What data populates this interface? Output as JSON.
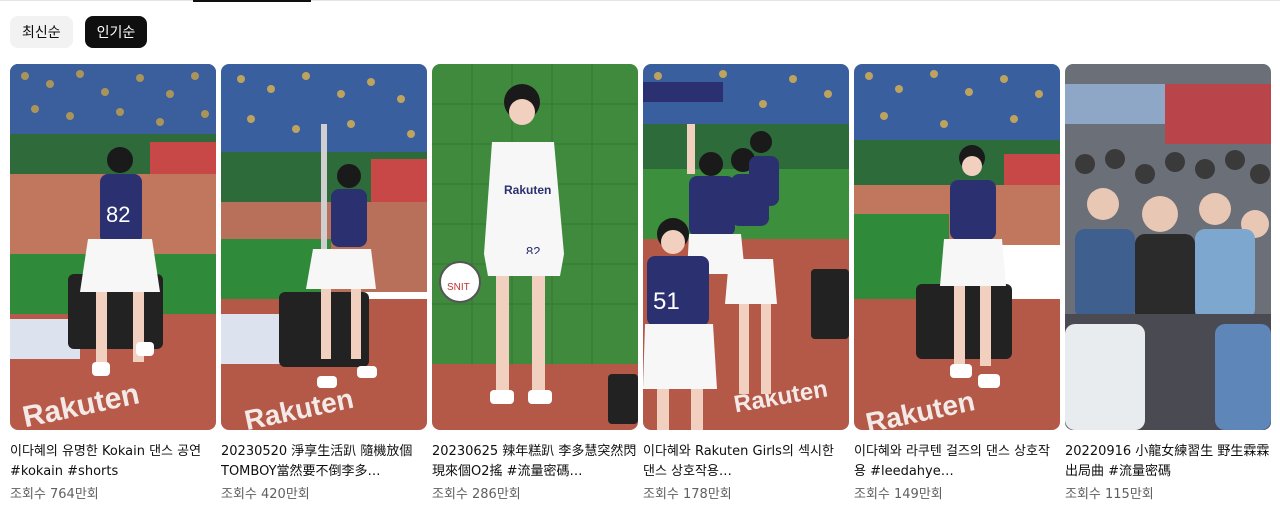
{
  "sort_chips": [
    {
      "label": "최신순",
      "active": false
    },
    {
      "label": "인기순",
      "active": true
    }
  ],
  "shorts": [
    {
      "title": "이다혜의 유명한 Kokain 댄스 공연 #kokain #shorts",
      "views": "조회수 764만회",
      "jersey": "82",
      "banner": "Rakuten"
    },
    {
      "title": "20230520 淨享生活趴 隨機放個TOMBOY當然要不倒李多…",
      "views": "조회수 420만회",
      "jersey": "",
      "banner": "Rakuten"
    },
    {
      "title": "20230625 辣年糕趴 李多慧突然閃現來個O2搖 #流量密碼…",
      "views": "조회수 286만회",
      "jersey": "82",
      "banner": ""
    },
    {
      "title": "이다혜와 Rakuten Girls의 섹시한 댄스 상호작용…",
      "views": "조회수 178만회",
      "jersey": "51",
      "banner": "Rakuten"
    },
    {
      "title": "이다혜와 라쿠텐 걸즈의 댄스 상호작용 #leedahye…",
      "views": "조회수 149만회",
      "jersey": "",
      "banner": "Rakuten"
    },
    {
      "title": "20220916 小龍女練習生 野生霖霖 出局曲 #流量密碼",
      "views": "조회수 115만회",
      "jersey": "",
      "banner": ""
    }
  ],
  "colors": {
    "chip_active_bg": "#0f0f0f",
    "chip_inactive_bg": "#f2f2f2",
    "stands_blue": "#2f5fa8",
    "field_green": "#3f8a3c",
    "dirt": "#b85a4a",
    "uniform_navy": "#2b3170"
  }
}
